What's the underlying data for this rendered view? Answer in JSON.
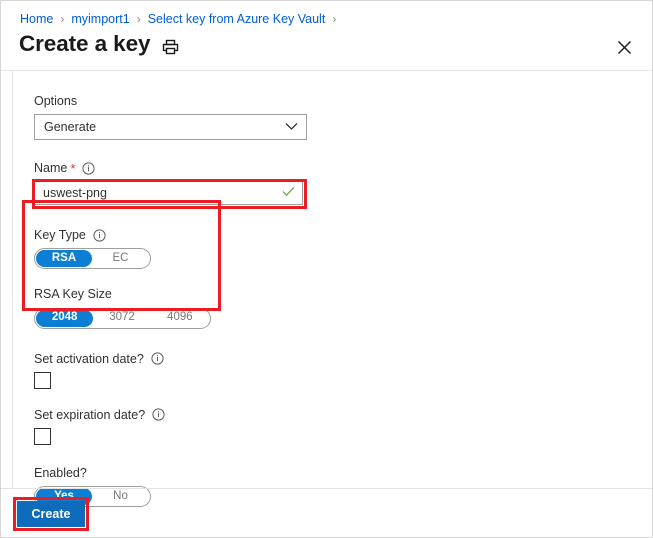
{
  "breadcrumb": {
    "items": [
      {
        "label": "Home"
      },
      {
        "label": "myimport1"
      },
      {
        "label": "Select key from Azure Key Vault"
      }
    ],
    "separator": "›"
  },
  "header": {
    "title": "Create a key",
    "print_icon": "printer-icon",
    "close_icon": "close-icon",
    "close_glyph": "✕"
  },
  "form": {
    "options": {
      "label": "Options",
      "value": "Generate",
      "chevron_icon": "chevron-down-icon"
    },
    "name": {
      "label": "Name",
      "required_marker": "*",
      "info_icon": "info-icon",
      "value": "uswest-png",
      "placeholder": "",
      "valid_icon": "checkmark-icon"
    },
    "key_type": {
      "label": "Key Type",
      "info_icon": "info-icon",
      "options": [
        {
          "label": "RSA",
          "selected": true
        },
        {
          "label": "EC",
          "selected": false
        }
      ]
    },
    "rsa_key_size": {
      "label": "RSA Key Size",
      "options": [
        {
          "label": "2048",
          "selected": true
        },
        {
          "label": "3072",
          "selected": false
        },
        {
          "label": "4096",
          "selected": false
        }
      ]
    },
    "set_activation_date": {
      "label": "Set activation date?",
      "info_icon": "info-icon",
      "checked": false
    },
    "set_expiration_date": {
      "label": "Set expiration date?",
      "info_icon": "info-icon",
      "checked": false
    },
    "enabled": {
      "label": "Enabled?",
      "options": [
        {
          "label": "Yes",
          "selected": true
        },
        {
          "label": "No",
          "selected": false
        }
      ]
    }
  },
  "footer": {
    "create_label": "Create"
  },
  "colors": {
    "link": "#015cda",
    "accent_blue": "#0c7fd4",
    "primary_button": "#0f6cbd",
    "highlight_red": "#ec1c24",
    "required_red": "#d13438",
    "valid_green": "#6aa84f"
  }
}
